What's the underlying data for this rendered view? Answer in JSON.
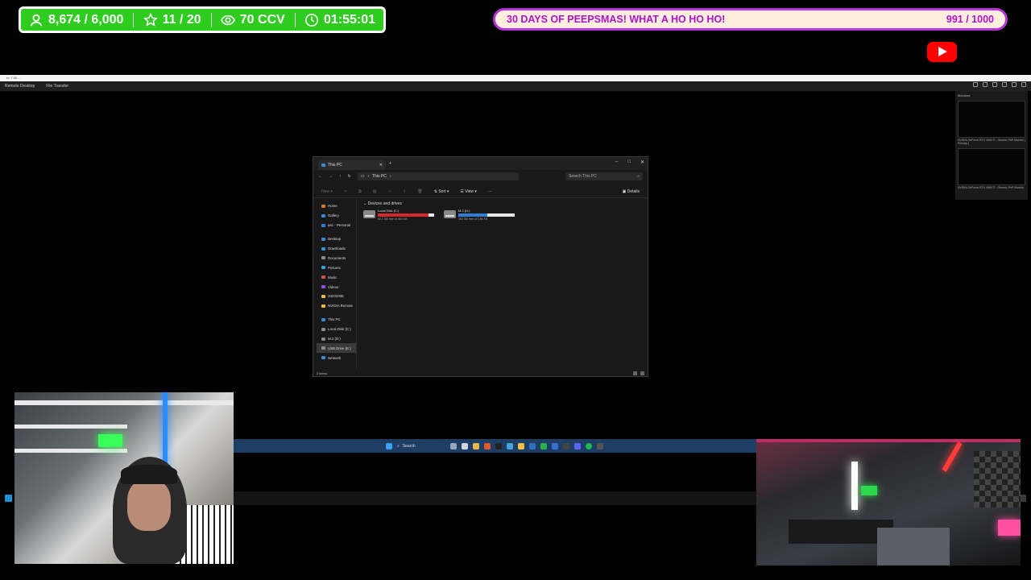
{
  "overlay": {
    "followers": "8,674 / 6,000",
    "subs": "11 / 20",
    "ccv": "70 CCV",
    "timer": "01:55:01",
    "goal_title": "30 DAYS OF PEEPSMAS! WHAT A HO HO HO!",
    "goal_count": "991 / 1000",
    "colors": {
      "stat_green": "#2ecc1f",
      "goal_border": "#b636d8",
      "goal_text": "#b012c9"
    }
  },
  "remote_app": {
    "title": "tv: 7.50 ...",
    "menu": [
      "Remote Desktop",
      "File Transfer"
    ],
    "monitors_title": "Monitors",
    "monitor1_label": "NVIDIA GeForce RTX 4060 Ti - Generic PnP Monitor [ Primary ]",
    "monitor2_label": "NVIDIA GeForce RTX 4060 Ti - Generic PnP Monitor"
  },
  "explorer": {
    "tab_title": "This PC",
    "breadcrumb": "This PC",
    "search_placeholder": "Search This PC",
    "toolbar": {
      "new": "New",
      "sort": "Sort",
      "view": "View",
      "more": "···",
      "details": "Details"
    },
    "nav": [
      {
        "label": "Home",
        "color": "#d07a2a"
      },
      {
        "label": "Gallery",
        "color": "#3a8ad6"
      },
      {
        "label": "asc - Personal",
        "color": "#2a7fd6"
      },
      {
        "label": "Desktop",
        "color": "#3a8ad6"
      },
      {
        "label": "Downloads",
        "color": "#2a9ad6"
      },
      {
        "label": "Documents",
        "color": "#8a8a8a"
      },
      {
        "label": "Pictures",
        "color": "#3aa0d6"
      },
      {
        "label": "Music",
        "color": "#d05050"
      },
      {
        "label": "Videos",
        "color": "#8a50d6"
      },
      {
        "label": "20231005",
        "color": "#e8b84a"
      },
      {
        "label": "NVIDIA Remote",
        "color": "#e8b84a"
      },
      {
        "label": "This PC",
        "color": "#3a8ad6"
      },
      {
        "label": "Local Disk (C:)",
        "color": "#888"
      },
      {
        "label": "M.2 (D:)",
        "color": "#888"
      },
      {
        "label": "USB Drive (E:)",
        "color": "#888"
      },
      {
        "label": "Network",
        "color": "#3a8ad6"
      }
    ],
    "section": "Devices and drives",
    "drives": [
      {
        "name": "Local Disk (C:)",
        "free": "92.1 GB free of 953 GB",
        "used_fraction": 0.9,
        "bar_color": "#d9262c"
      },
      {
        "name": "M.2 (D:)",
        "free": "382 GB free of 1.86 TB",
        "used_fraction": 0.52,
        "bar_color": "#2a7fd6"
      }
    ],
    "status": "2 items"
  },
  "taskbar": {
    "search_label": "Search"
  }
}
